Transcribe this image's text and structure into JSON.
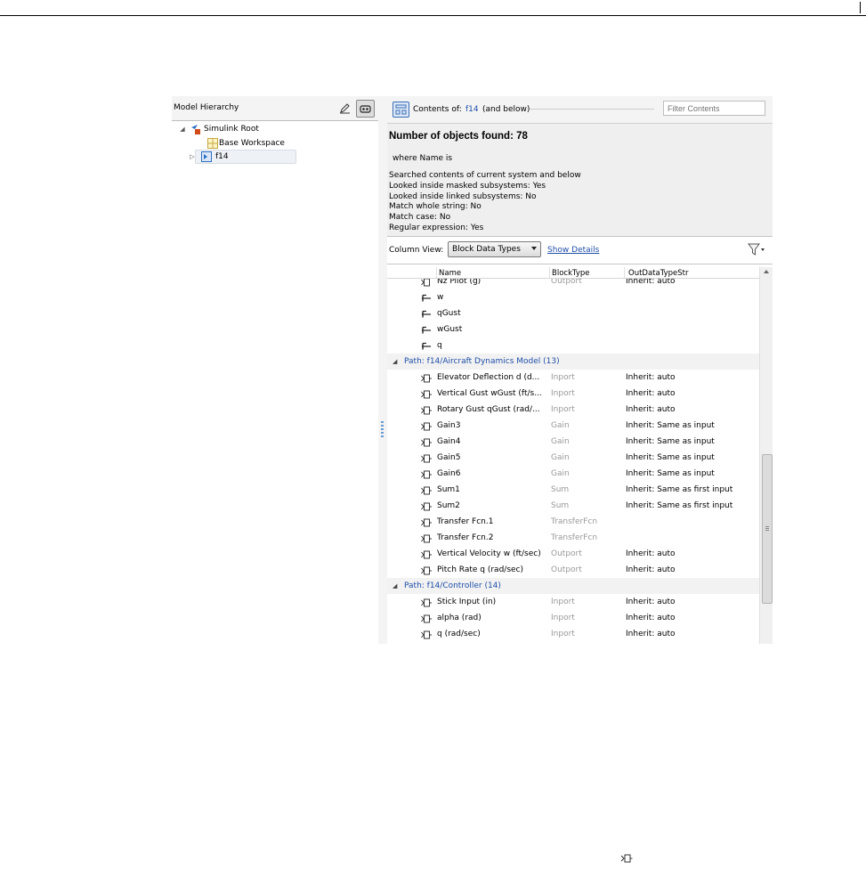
{
  "left_pane": {
    "title": "Model Hierarchy",
    "tree": {
      "root": "Simulink Root",
      "base": "Base Workspace",
      "model": "f14"
    }
  },
  "right_pane": {
    "contents_label": "Contents of:",
    "contents_link": "f14",
    "contents_scope": "(and below)",
    "filter_placeholder": "Filter Contents",
    "search": {
      "count": "Number of objects found: 78",
      "where": "where Name is",
      "lines": [
        "Searched contents of current system and below",
        "Looked inside masked subsystems: Yes",
        "Looked inside linked subsystems: No",
        "Match whole string: No",
        "Match case: No",
        "Regular expression: Yes"
      ]
    },
    "column_view_label": "Column View:",
    "column_view_value": "Block Data Types",
    "show_details": "Show Details",
    "columns": {
      "name": "Name",
      "blocktype": "BlockType",
      "outdatatype": "OutDataTypeStr"
    },
    "rows": [
      {
        "kind": "block",
        "icon": "outport",
        "name": "Nz Pilot (g)",
        "type": "Outport",
        "out": "Inherit: auto"
      },
      {
        "kind": "signal",
        "icon": "signal",
        "name": "w",
        "type": "",
        "out": ""
      },
      {
        "kind": "signal",
        "icon": "signal",
        "name": "qGust",
        "type": "",
        "out": ""
      },
      {
        "kind": "signal",
        "icon": "signal",
        "name": "wGust",
        "type": "",
        "out": ""
      },
      {
        "kind": "signal",
        "icon": "signal",
        "name": "q",
        "type": "",
        "out": ""
      },
      {
        "kind": "group",
        "name": "Path: f14/Aircraft Dynamics Model (13)"
      },
      {
        "kind": "block",
        "icon": "block",
        "name": "Elevator Deflection d (d...",
        "type": "Inport",
        "out": "Inherit: auto"
      },
      {
        "kind": "block",
        "icon": "block",
        "name": "Vertical Gust wGust (ft/s...",
        "type": "Inport",
        "out": "Inherit: auto"
      },
      {
        "kind": "block",
        "icon": "block",
        "name": "Rotary Gust qGust (rad/...",
        "type": "Inport",
        "out": "Inherit: auto"
      },
      {
        "kind": "block",
        "icon": "block",
        "name": "Gain3",
        "type": "Gain",
        "out": "Inherit: Same as input"
      },
      {
        "kind": "block",
        "icon": "block",
        "name": "Gain4",
        "type": "Gain",
        "out": "Inherit: Same as input"
      },
      {
        "kind": "block",
        "icon": "block",
        "name": "Gain5",
        "type": "Gain",
        "out": "Inherit: Same as input"
      },
      {
        "kind": "block",
        "icon": "block",
        "name": "Gain6",
        "type": "Gain",
        "out": "Inherit: Same as input"
      },
      {
        "kind": "block",
        "icon": "block",
        "name": "Sum1",
        "type": "Sum",
        "out": "Inherit: Same as first input"
      },
      {
        "kind": "block",
        "icon": "block",
        "name": "Sum2",
        "type": "Sum",
        "out": "Inherit: Same as first input"
      },
      {
        "kind": "block",
        "icon": "block",
        "name": "Transfer Fcn.1",
        "type": "TransferFcn",
        "out": ""
      },
      {
        "kind": "block",
        "icon": "block",
        "name": "Transfer Fcn.2",
        "type": "TransferFcn",
        "out": ""
      },
      {
        "kind": "block",
        "icon": "block",
        "name": "Vertical Velocity w (ft/sec)",
        "type": "Outport",
        "out": "Inherit: auto"
      },
      {
        "kind": "block",
        "icon": "block",
        "name": "Pitch Rate q (rad/sec)",
        "type": "Outport",
        "out": "Inherit: auto"
      },
      {
        "kind": "group",
        "name": "Path: f14/Controller (14)"
      },
      {
        "kind": "block",
        "icon": "block",
        "name": "Stick Input (in)",
        "type": "Inport",
        "out": "Inherit: auto"
      },
      {
        "kind": "block",
        "icon": "block",
        "name": "alpha (rad)",
        "type": "Inport",
        "out": "Inherit: auto"
      },
      {
        "kind": "block",
        "icon": "block",
        "name": "q (rad/sec)",
        "type": "Inport",
        "out": "Inherit: auto"
      }
    ]
  },
  "colors": {
    "link": "#1f4fa8",
    "muted": "#999999",
    "panel": "#efefef"
  }
}
